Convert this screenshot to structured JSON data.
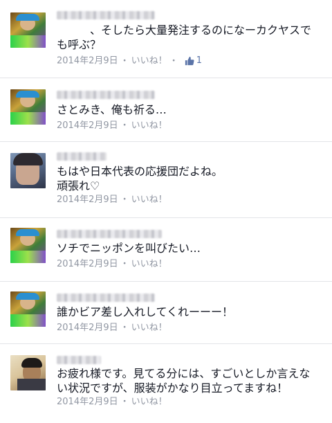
{
  "comments": [
    {
      "avatar": "cap-man-colorful-photo",
      "text": "　　　、そしたら大量発注するのになーカクヤスでも呼ぶ？",
      "date": "2014年2月9日",
      "like_label": "いいね！",
      "like_count": "1",
      "like_icon": "thumbs-up-icon"
    },
    {
      "avatar": "cap-man-colorful-photo",
      "text": "さとみき、俺も祈る…",
      "date": "2014年2月9日",
      "like_label": "いいね！"
    },
    {
      "avatar": "girl-blue-photo",
      "text": "もはや日本代表の応援団だよね。\n頑張れ♡",
      "date": "2014年2月9日",
      "like_label": "いいね！"
    },
    {
      "avatar": "cap-man-colorful-photo",
      "text": "ソチでニッポンを叫びたい…",
      "date": "2014年2月9日",
      "like_label": "いいね！"
    },
    {
      "avatar": "cap-man-colorful-photo",
      "text": "誰かビア差し入れしてくれーーー！",
      "date": "2014年2月9日",
      "like_label": "いいね！"
    },
    {
      "avatar": "man-window-photo",
      "text": "お疲れ様です。見てる分には、すごいとしか言えない状況ですが、服装がかなり目立ってますね！",
      "date": "2014年2月9日",
      "like_label": "いいね！"
    }
  ],
  "separator": "・",
  "colors": {
    "text": "#141823",
    "meta": "#9197a3",
    "link": "#5b74a8",
    "divider": "#e3e4e8"
  }
}
